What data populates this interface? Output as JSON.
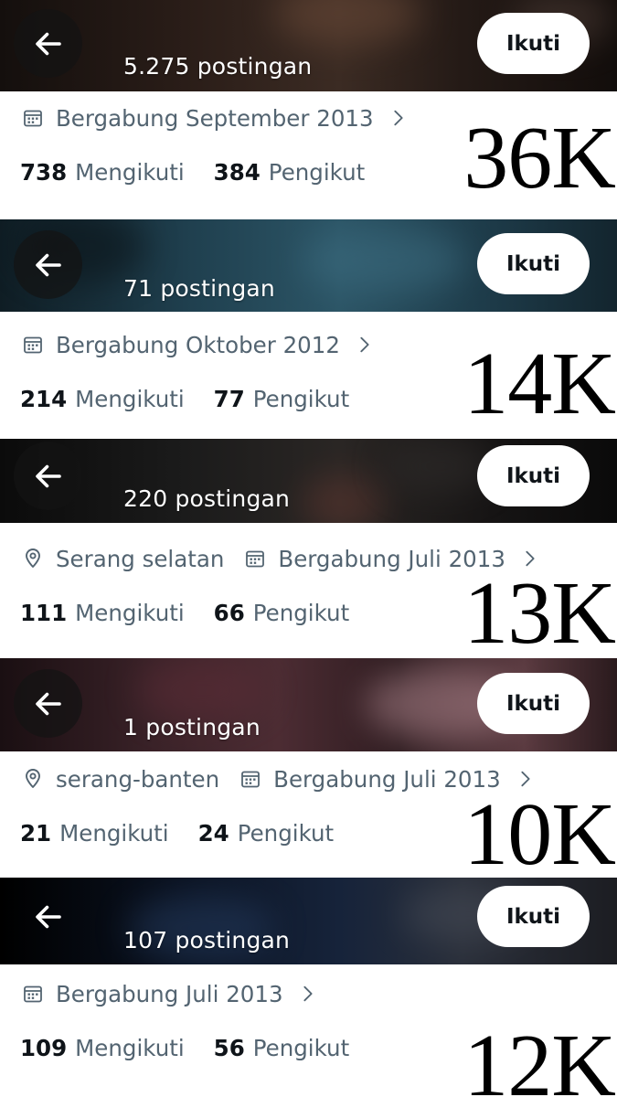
{
  "cards": [
    {
      "posts": "5.275 postingan",
      "follow_label": "Ikuti",
      "location": "",
      "joined": "Bergabung September 2013",
      "following_count": "738",
      "following_label": "Mengikuti",
      "followers_count": "384",
      "followers_label": "Pengikut",
      "overlay": "36K"
    },
    {
      "posts": "71 postingan",
      "follow_label": "Ikuti",
      "location": "",
      "joined": "Bergabung Oktober 2012",
      "following_count": "214",
      "following_label": "Mengikuti",
      "followers_count": "77",
      "followers_label": "Pengikut",
      "overlay": "14K"
    },
    {
      "posts": "220 postingan",
      "follow_label": "Ikuti",
      "location": "Serang selatan",
      "joined": "Bergabung Juli 2013",
      "following_count": "111",
      "following_label": "Mengikuti",
      "followers_count": "66",
      "followers_label": "Pengikut",
      "overlay": "13K"
    },
    {
      "posts": "1 postingan",
      "follow_label": "Ikuti",
      "location": "serang-banten",
      "joined": "Bergabung Juli 2013",
      "following_count": "21",
      "following_label": "Mengikuti",
      "followers_count": "24",
      "followers_label": "Pengikut",
      "overlay": "10K"
    },
    {
      "posts": "107 postingan",
      "follow_label": "Ikuti",
      "location": "",
      "joined": "Bergabung Juli 2013",
      "following_count": "109",
      "following_label": "Mengikuti",
      "followers_count": "56",
      "followers_label": "Pengikut",
      "overlay": "12K"
    }
  ],
  "icons": {
    "back": "arrow-left-icon",
    "calendar": "calendar-icon",
    "location": "location-pin-icon",
    "chevron": "chevron-right-icon"
  },
  "colors": {
    "text_primary": "#0f1419",
    "text_secondary": "#536471",
    "button_bg": "#ffffff",
    "banner_1": "#1a1412",
    "banner_2": "#1d3a48",
    "banner_3": "#111111",
    "banner_4": "#3a2328",
    "banner_5": "#0d1522"
  }
}
